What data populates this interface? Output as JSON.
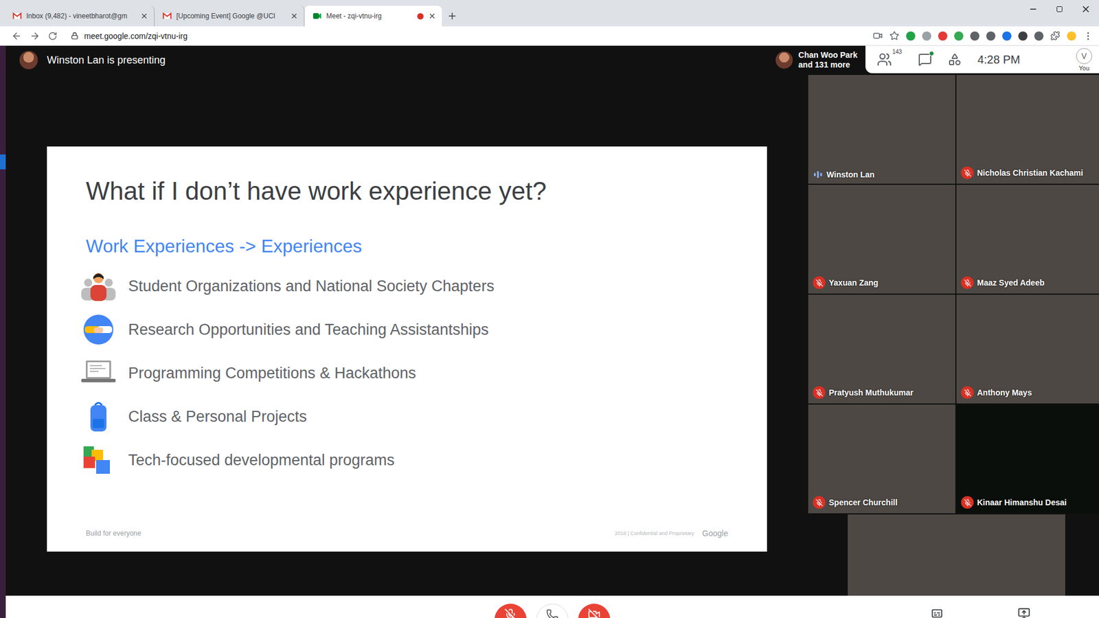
{
  "browser": {
    "tabs": [
      {
        "label": "Inbox (9,482) - vineetbharot@gm",
        "selected": false,
        "recording": false,
        "kind": "gmail"
      },
      {
        "label": "[Upcoming Event] Google @UCI",
        "selected": false,
        "recording": false,
        "kind": "gmail"
      },
      {
        "label": "Meet - zqi-vtnu-irg",
        "selected": true,
        "recording": true,
        "kind": "meet"
      }
    ],
    "url": "meet.google.com/zqi-vtnu-irg"
  },
  "meeting": {
    "presenter": "Winston Lan is presenting",
    "others": {
      "lead": "Chan Woo Park",
      "more": "and 131 more"
    },
    "participant_count": "143",
    "chat_unread": true,
    "time": "4:28 PM",
    "self": {
      "label": "You",
      "initial": "V"
    }
  },
  "slide": {
    "title": "What if I don’t have work experience yet?",
    "subtitle": "Work Experiences -> Experiences",
    "items": [
      {
        "label": "Student Organizations and National Society Chapters",
        "kind": "people"
      },
      {
        "label": "Research Opportunities and Teaching Assistantships",
        "kind": "handshake"
      },
      {
        "label": "Programming Competitions & Hackathons",
        "kind": "laptop"
      },
      {
        "label": "Class & Personal Projects",
        "kind": "backpack"
      },
      {
        "label": "Tech-focused developmental programs",
        "kind": "blocks"
      }
    ],
    "footer": {
      "left": "Build for everyone",
      "note": "2018 | Confidential and Proprietary",
      "brand": "Google"
    }
  },
  "tiles": [
    {
      "name": "Winston Lan",
      "muted": false,
      "speaking": true,
      "camera": true
    },
    {
      "name": "Nicholas Christian Kachami",
      "muted": true,
      "speaking": false,
      "camera": true
    },
    {
      "name": "Yaxuan Zang",
      "muted": true,
      "speaking": false,
      "camera": true
    },
    {
      "name": "Maaz Syed Adeeb",
      "muted": true,
      "speaking": false,
      "camera": true
    },
    {
      "name": "Pratyush Muthukumar",
      "muted": true,
      "speaking": false,
      "camera": true
    },
    {
      "name": "Anthony Mays",
      "muted": true,
      "speaking": false,
      "camera": true
    },
    {
      "name": "Spencer Churchill",
      "muted": true,
      "speaking": false,
      "camera": true
    },
    {
      "name": "Kinaar Himanshu Desai",
      "muted": true,
      "speaking": false,
      "camera": false
    },
    {
      "muted": false,
      "speaking": false,
      "camera": true
    }
  ],
  "controls": {
    "mic_muted": true,
    "camera_off": true
  }
}
